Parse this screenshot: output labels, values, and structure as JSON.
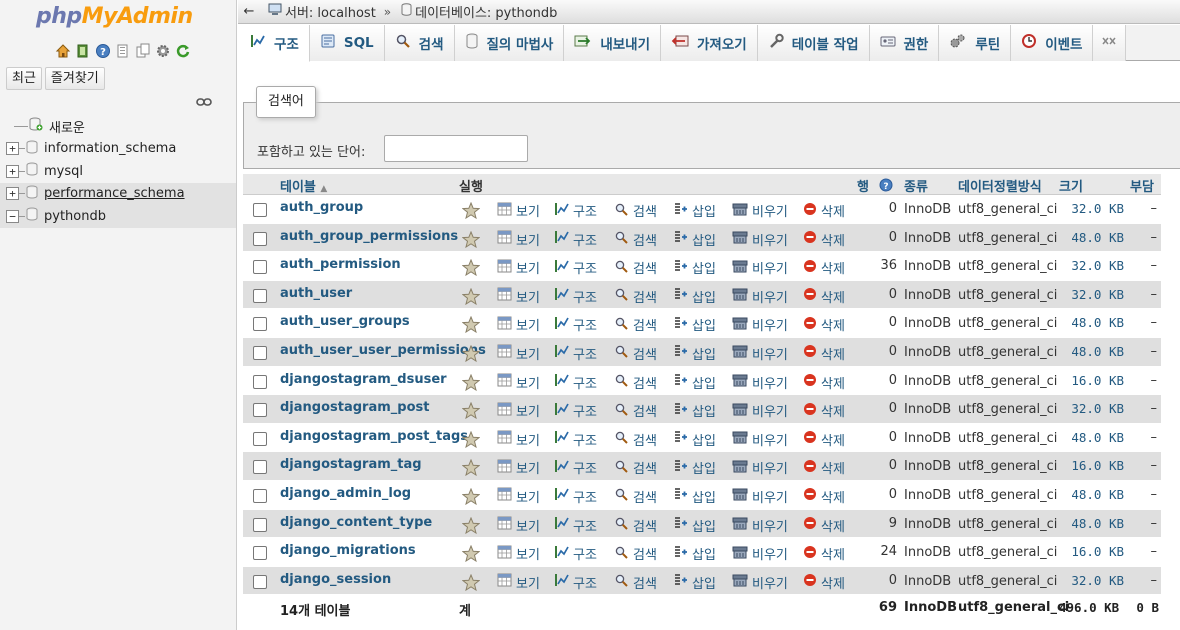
{
  "nav": {
    "logo_php": "php",
    "logo_myadmin": "MyAdmin",
    "tabs": {
      "recent": "최근",
      "favorites": "즐겨찾기"
    },
    "tree": [
      {
        "label": "새로운",
        "type": "new"
      },
      {
        "label": "information_schema",
        "type": "db"
      },
      {
        "label": "mysql",
        "type": "db"
      },
      {
        "label": "performance_schema",
        "type": "db"
      },
      {
        "label": "pythondb",
        "type": "db"
      }
    ]
  },
  "topbar": {
    "back": "←",
    "server": "서버: localhost",
    "separator": "»",
    "database": "데이터베이스: pythondb"
  },
  "tabs": [
    {
      "label": "구조",
      "icon": "structure-icon"
    },
    {
      "label": "SQL",
      "icon": "sql-icon"
    },
    {
      "label": "검색",
      "icon": "search-icon"
    },
    {
      "label": "질의 마법사",
      "icon": "query-icon"
    },
    {
      "label": "내보내기",
      "icon": "export-icon"
    },
    {
      "label": "가져오기",
      "icon": "import-icon"
    },
    {
      "label": "테이블 작업",
      "icon": "operations-icon"
    },
    {
      "label": "권한",
      "icon": "privileges-icon"
    },
    {
      "label": "루틴",
      "icon": "routines-icon"
    },
    {
      "label": "이벤트",
      "icon": "events-icon"
    }
  ],
  "filter": {
    "legend": "검색어",
    "label": "포함하고 있는 단어:",
    "value": ""
  },
  "table": {
    "headers": {
      "table": "테이블",
      "action": "실행",
      "rows": "행",
      "type": "종류",
      "collation": "데이터정렬방식",
      "size": "크기",
      "overhead": "부담"
    },
    "actions": {
      "browse": "보기",
      "structure": "구조",
      "search": "검색",
      "insert": "삽입",
      "empty": "비우기",
      "drop": "삭제"
    },
    "rows": [
      {
        "name": "auth_group",
        "rows": "0",
        "engine": "InnoDB",
        "collation": "utf8_general_ci",
        "size": "32.0 KB",
        "overhead": "–"
      },
      {
        "name": "auth_group_permissions",
        "rows": "0",
        "engine": "InnoDB",
        "collation": "utf8_general_ci",
        "size": "48.0 KB",
        "overhead": "–"
      },
      {
        "name": "auth_permission",
        "rows": "36",
        "engine": "InnoDB",
        "collation": "utf8_general_ci",
        "size": "32.0 KB",
        "overhead": "–"
      },
      {
        "name": "auth_user",
        "rows": "0",
        "engine": "InnoDB",
        "collation": "utf8_general_ci",
        "size": "32.0 KB",
        "overhead": "–"
      },
      {
        "name": "auth_user_groups",
        "rows": "0",
        "engine": "InnoDB",
        "collation": "utf8_general_ci",
        "size": "48.0 KB",
        "overhead": "–"
      },
      {
        "name": "auth_user_user_permissions",
        "rows": "0",
        "engine": "InnoDB",
        "collation": "utf8_general_ci",
        "size": "48.0 KB",
        "overhead": "–"
      },
      {
        "name": "djangostagram_dsuser",
        "rows": "0",
        "engine": "InnoDB",
        "collation": "utf8_general_ci",
        "size": "16.0 KB",
        "overhead": "–"
      },
      {
        "name": "djangostagram_post",
        "rows": "0",
        "engine": "InnoDB",
        "collation": "utf8_general_ci",
        "size": "32.0 KB",
        "overhead": "–"
      },
      {
        "name": "djangostagram_post_tags",
        "rows": "0",
        "engine": "InnoDB",
        "collation": "utf8_general_ci",
        "size": "48.0 KB",
        "overhead": "–"
      },
      {
        "name": "djangostagram_tag",
        "rows": "0",
        "engine": "InnoDB",
        "collation": "utf8_general_ci",
        "size": "16.0 KB",
        "overhead": "–"
      },
      {
        "name": "django_admin_log",
        "rows": "0",
        "engine": "InnoDB",
        "collation": "utf8_general_ci",
        "size": "48.0 KB",
        "overhead": "–"
      },
      {
        "name": "django_content_type",
        "rows": "9",
        "engine": "InnoDB",
        "collation": "utf8_general_ci",
        "size": "48.0 KB",
        "overhead": "–"
      },
      {
        "name": "django_migrations",
        "rows": "24",
        "engine": "InnoDB",
        "collation": "utf8_general_ci",
        "size": "16.0 KB",
        "overhead": "–"
      },
      {
        "name": "django_session",
        "rows": "0",
        "engine": "InnoDB",
        "collation": "utf8_general_ci",
        "size": "32.0 KB",
        "overhead": "–"
      }
    ],
    "footer": {
      "count": "14개 테이블",
      "total_label": "계",
      "rows": "69",
      "engine": "InnoDB",
      "collation": "utf8_general_ci",
      "size": "496.0 KB",
      "overhead": "0 B"
    }
  },
  "colors": {
    "link": "#235a81",
    "logo_php": "#6c78af",
    "logo_myadmin": "#f89c0e",
    "row_even": "#dfdfdf",
    "drop_icon": "#d9341f"
  }
}
